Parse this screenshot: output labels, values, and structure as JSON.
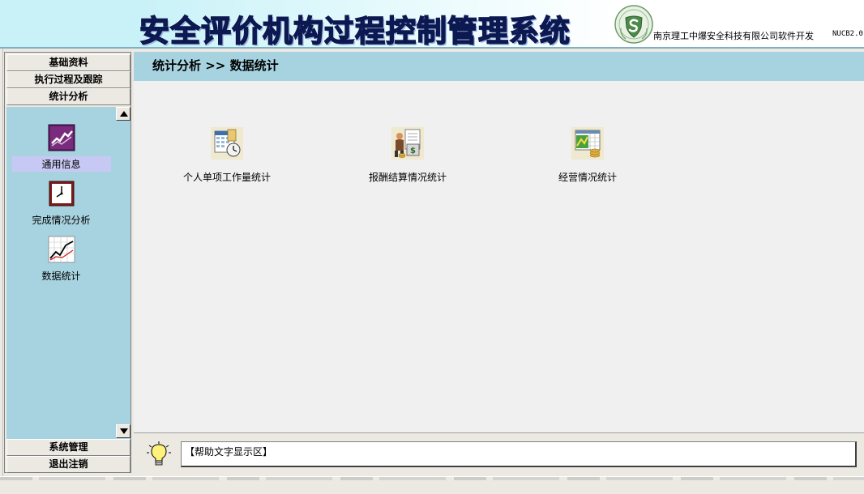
{
  "header": {
    "app_title": "安全评价机构过程控制管理系统",
    "company": "南京理工中爆安全科技有限公司软件开发",
    "version": "NUCB2.0",
    "logo_icon": "shield-logo-icon"
  },
  "left_menu": {
    "top_items": [
      {
        "label": "基础资料"
      },
      {
        "label": "执行过程及跟踪"
      },
      {
        "label": "统计分析"
      }
    ],
    "nav_items": [
      {
        "label": "通用信息",
        "icon": "trend-chart-icon",
        "selected": true
      },
      {
        "label": "完成情况分析",
        "icon": "clock-icon",
        "selected": false
      },
      {
        "label": "数据统计",
        "icon": "line-graph-icon",
        "selected": false
      }
    ],
    "bottom_items": [
      {
        "label": "系统管理"
      },
      {
        "label": "退出注销"
      }
    ]
  },
  "breadcrumb": "统计分析  >>  数据统计",
  "features": [
    {
      "label": "个人单项工作量统计",
      "icon": "calendar-clock-icon"
    },
    {
      "label": "报酬结算情况统计",
      "icon": "money-document-icon"
    },
    {
      "label": "经营情况统计",
      "icon": "spreadsheet-coins-icon"
    }
  ],
  "help": {
    "text": "【帮助文字显示区】",
    "icon": "lightbulb-icon"
  },
  "colors": {
    "panel_blue": "#a7d3e0",
    "header_cyan": "#c8f2f8",
    "title_navy": "#1d2f6e",
    "selected_lavender": "#c8c8f4",
    "window_gray": "#ece9e2"
  }
}
